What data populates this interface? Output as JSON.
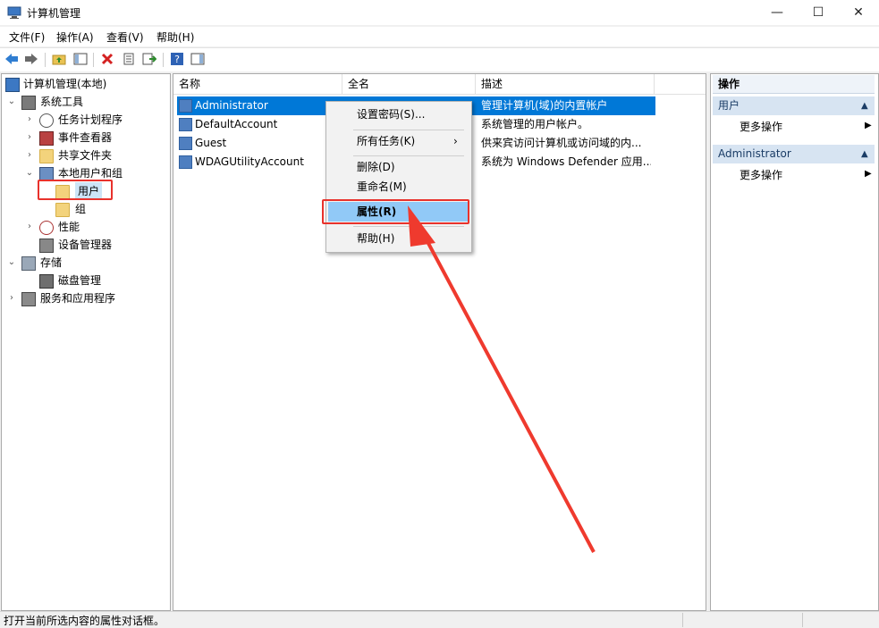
{
  "window": {
    "title": "计算机管理",
    "minimize": "—",
    "maximize": "☐",
    "close": "✕"
  },
  "menu": [
    "文件(F)",
    "操作(A)",
    "查看(V)",
    "帮助(H)"
  ],
  "tree": {
    "root": "计算机管理(本地)",
    "system_tools": "系统工具",
    "task_scheduler": "任务计划程序",
    "event_viewer": "事件查看器",
    "shared_folders": "共享文件夹",
    "local_users_groups": "本地用户和组",
    "users": "用户",
    "groups": "组",
    "performance": "性能",
    "device_manager": "设备管理器",
    "storage": "存储",
    "disk_management": "磁盘管理",
    "services_apps": "服务和应用程序"
  },
  "list": {
    "columns": [
      "名称",
      "全名",
      "描述"
    ],
    "rows": [
      {
        "name": "Administrator",
        "full_name": "",
        "description": "管理计算机(域)的内置帐户"
      },
      {
        "name": "DefaultAccount",
        "full_name": "",
        "description": "系统管理的用户帐户。"
      },
      {
        "name": "Guest",
        "full_name": "",
        "description": "供来宾访问计算机或访问域的内..."
      },
      {
        "name": "WDAGUtilityAccount",
        "full_name": "",
        "description": "系统为 Windows Defender 应用..."
      }
    ]
  },
  "context_menu": {
    "set_password": "设置密码(S)...",
    "all_tasks": "所有任务(K)",
    "delete": "删除(D)",
    "rename": "重命名(M)",
    "properties": "属性(R)",
    "help": "帮助(H)"
  },
  "actions": {
    "header": "操作",
    "section_users": "用户",
    "more_actions_1": "更多操作",
    "section_admin": "Administrator",
    "more_actions_2": "更多操作"
  },
  "status": {
    "text": "打开当前所选内容的属性对话框。"
  },
  "colors": {
    "selection": "#0078d7",
    "menu_highlight": "#91c9f7",
    "annotation": "#e8322c",
    "action_section": "#d7e4f2"
  }
}
